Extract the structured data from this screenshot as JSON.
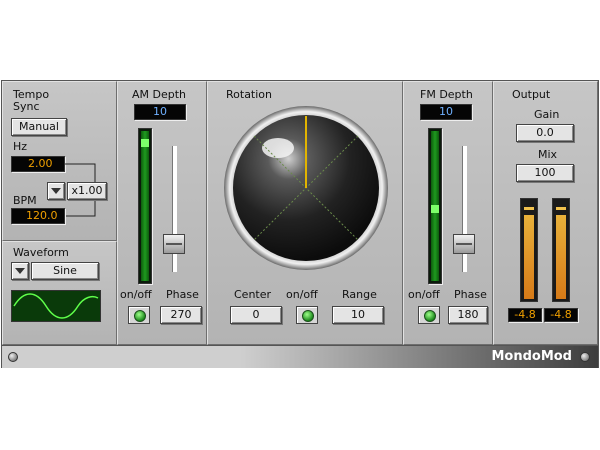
{
  "tempo": {
    "title": "Tempo",
    "sync_label": "Sync",
    "sync_button": "Manual",
    "hz_label": "Hz",
    "hz_value": "2.00",
    "bpm_label": "BPM",
    "bpm_value": "120.0",
    "multiplier": "x1.00"
  },
  "waveform": {
    "title": "Waveform",
    "selected": "Sine"
  },
  "am": {
    "title": "AM Depth",
    "value": "10",
    "onoff_label": "on/off",
    "phase_label": "Phase",
    "phase_value": "270"
  },
  "rotation": {
    "title": "Rotation",
    "center_label": "Center",
    "center_value": "0",
    "onoff_label": "on/off",
    "range_label": "Range",
    "range_value": "10"
  },
  "fm": {
    "title": "FM Depth",
    "value": "10",
    "onoff_label": "on/off",
    "phase_label": "Phase",
    "phase_value": "180"
  },
  "output": {
    "title": "Output",
    "gain_label": "Gain",
    "gain_value": "0.0",
    "mix_label": "Mix",
    "mix_value": "100",
    "meter_left": "-4.8",
    "meter_right": "-4.8"
  },
  "brand": "MondoMod",
  "colors": {
    "panel": "#bdbdbd",
    "meter_green": "#1f9a1f",
    "readout_orange": "#f0a000",
    "readout_blue": "#6fb0ff"
  }
}
